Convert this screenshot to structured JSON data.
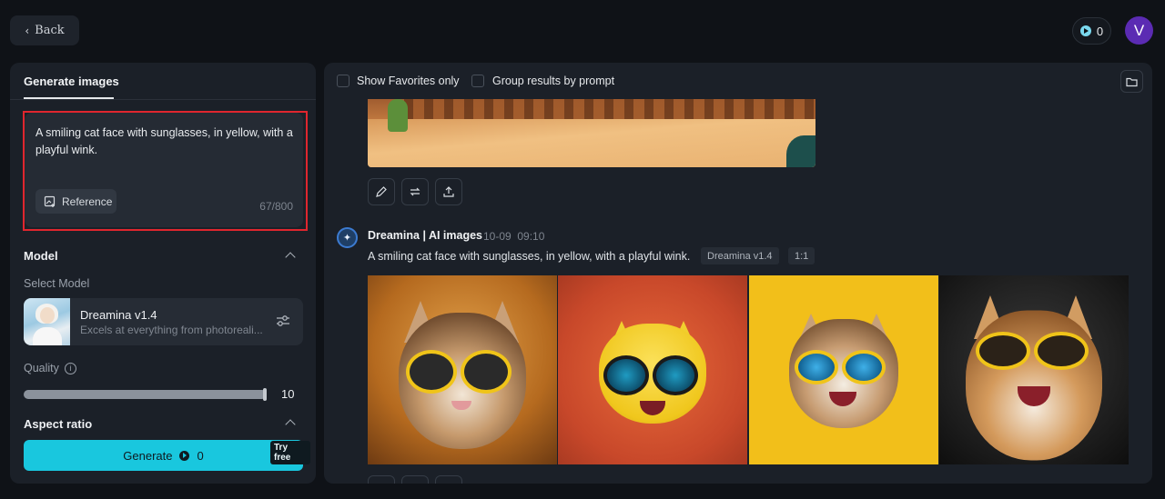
{
  "topbar": {
    "back_label": "Back",
    "credits": "0",
    "avatar_initial": "V"
  },
  "left": {
    "tab_label": "Generate images",
    "prompt_text": "A smiling cat face with sunglasses, in yellow, with a playful wink.",
    "reference_label": "Reference",
    "char_count": "67/800",
    "model_section_title": "Model",
    "select_model_label": "Select Model",
    "model_name": "Dreamina v1.4",
    "model_desc": "Excels at everything from photoreali...",
    "quality_label": "Quality",
    "quality_value": "10",
    "quality_level": 1.0,
    "aspect_ratio_title": "Aspect ratio",
    "generate_label": "Generate",
    "generate_credits": "0",
    "try_free_label": "Try free"
  },
  "right": {
    "favorites_label": "Show Favorites only",
    "group_label": "Group results by prompt",
    "author": "Dreamina | AI images",
    "date": "10-09",
    "time": "09:10",
    "prompt": "A smiling cat face with sunglasses, in yellow, with a playful wink.",
    "model_tag": "Dreamina v1.4",
    "ratio_tag": "1:1"
  },
  "colors": {
    "accent": "#19c7de",
    "highlight": "#e0262e",
    "avatar": "#5b2bb3"
  },
  "icons": [
    "chevron-left-icon",
    "credit-icon",
    "reference-icon",
    "chevron-up-icon",
    "settings-sliders-icon",
    "info-icon",
    "folder-icon",
    "edit-icon",
    "regenerate-icon",
    "upload-icon",
    "dreamina-logo-icon"
  ]
}
